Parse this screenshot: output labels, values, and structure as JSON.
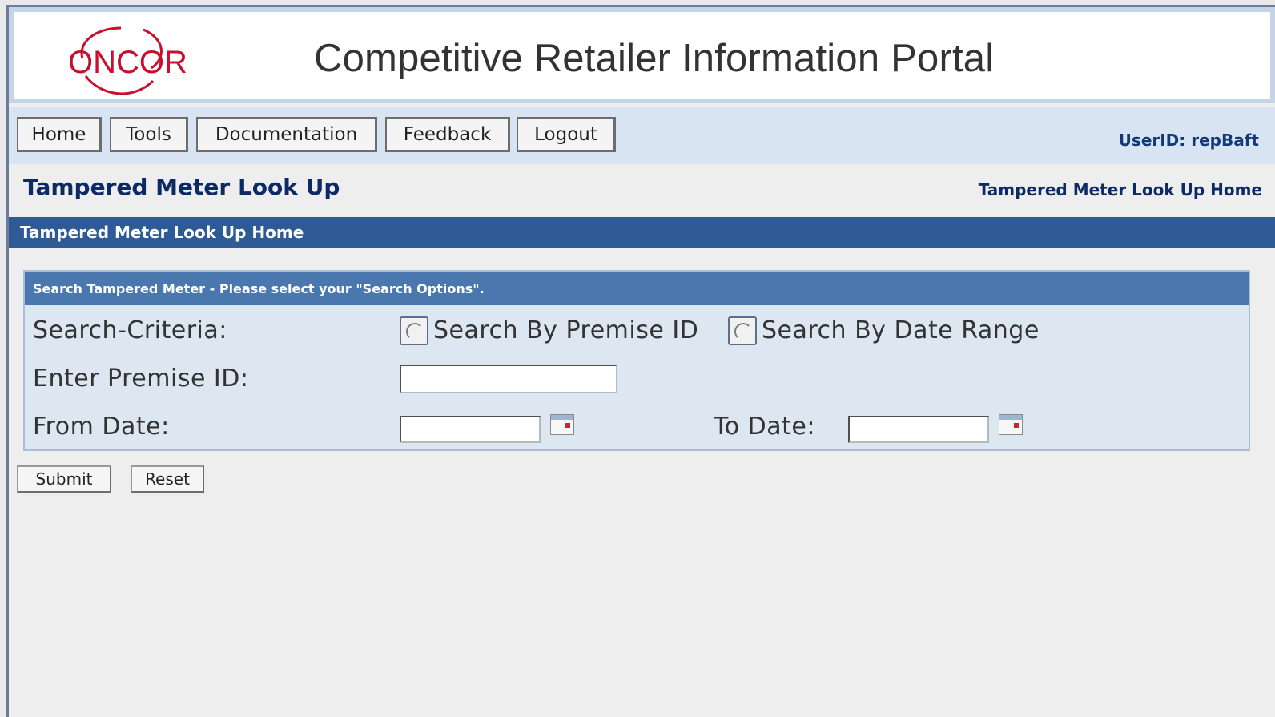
{
  "header": {
    "logo_text": "ONCOR",
    "title": "Competitive Retailer Information Portal"
  },
  "nav": {
    "items": [
      "Home",
      "Tools",
      "Documentation",
      "Feedback",
      "Logout"
    ],
    "userid": "UserID: repBaft"
  },
  "page": {
    "title": "Tampered Meter Look Up",
    "breadcrumb": "Tampered Meter Look Up Home",
    "section": "Tampered Meter Look Up Home"
  },
  "search": {
    "header": "Search Tampered Meter - Please select your \"Search Options\".",
    "criteria_label": "Search-Criteria:",
    "option_premise": "Search By Premise ID",
    "option_date": "Search By Date Range",
    "premise_label": "Enter Premise ID:",
    "premise_value": "",
    "from_label": "From Date:",
    "from_value": "",
    "to_label": "To Date:",
    "to_value": ""
  },
  "buttons": {
    "submit": "Submit",
    "reset": "Reset"
  },
  "colors": {
    "brand_red": "#c8102e",
    "nav_bar": "#d8e4f1",
    "section_bar": "#2e5b95",
    "panel_header": "#4a77ad",
    "title_text": "#0e2a66"
  }
}
